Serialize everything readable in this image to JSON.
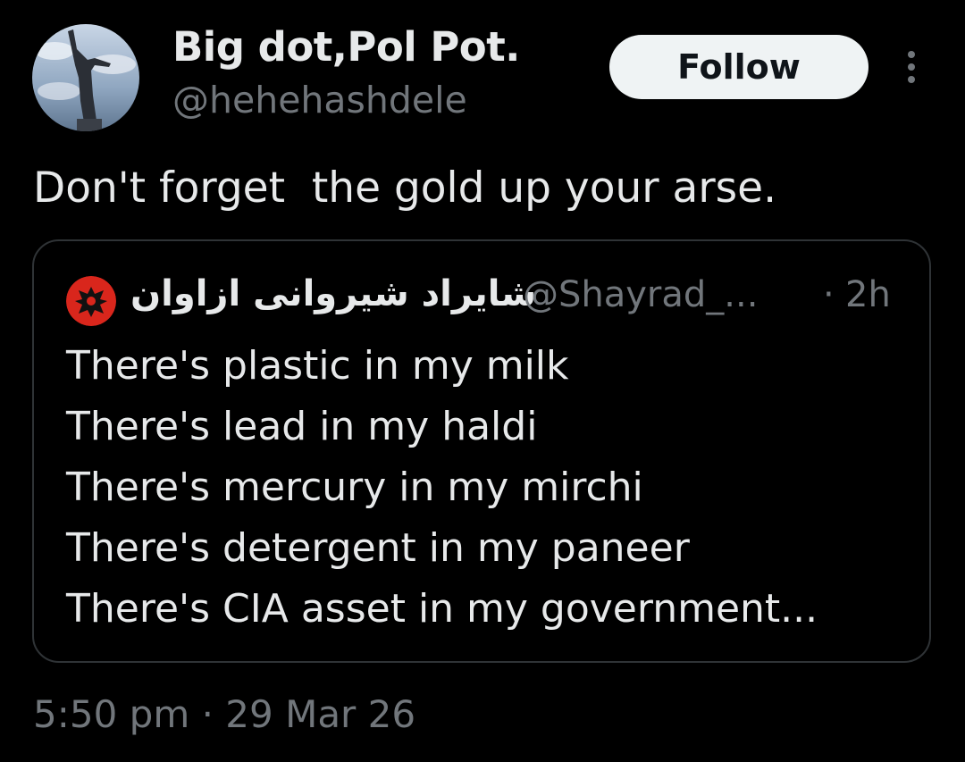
{
  "author": {
    "display_name": "Big dot,Pol Pot.",
    "handle": "@hehehashdele",
    "avatar_icon": "statue-avatar"
  },
  "follow_button": {
    "label": "Follow"
  },
  "more_menu": {
    "icon": "more-vertical-icon"
  },
  "tweet": {
    "text": "Don't forget  the gold up your arse."
  },
  "quoted_tweet": {
    "display_name": "شايراد شيروانى ازاوان",
    "handle": "@Shayrad_...",
    "separator": "·",
    "time": "2h",
    "avatar_icon": "eagle-emblem-avatar",
    "lines": [
      "There's plastic in my milk",
      "There's lead in my haldi",
      "There's mercury in my mirchi",
      "There's detergent in my paneer",
      "There's CIA asset in my government..."
    ]
  },
  "timestamp": "5:50 pm · 29 Mar 26",
  "colors": {
    "background": "#000000",
    "primary_text": "#e7e9ea",
    "secondary_text": "#71767b",
    "border": "#2f3336",
    "follow_bg": "#eff3f4"
  }
}
